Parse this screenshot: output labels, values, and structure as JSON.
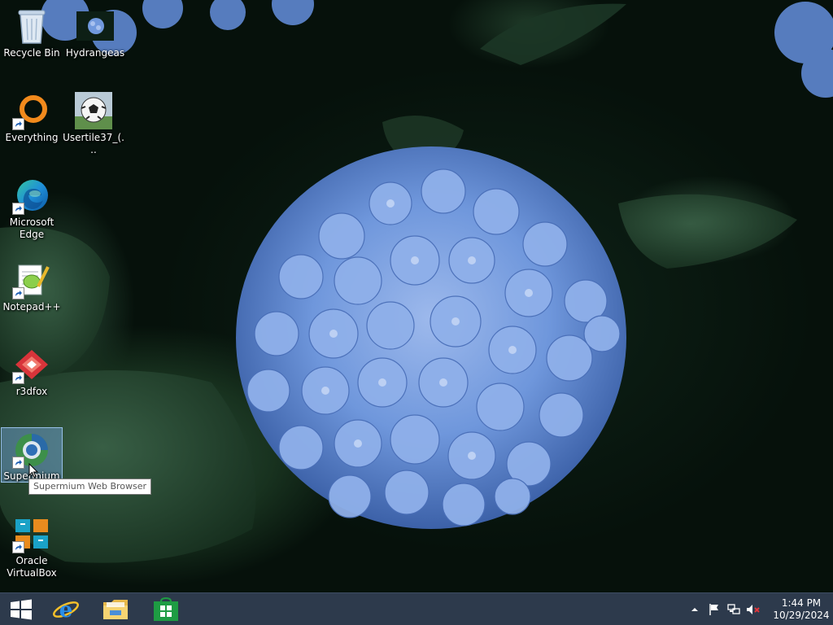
{
  "desktop": {
    "icons": [
      {
        "label": "Recycle Bin",
        "icon": "recycle-bin-icon"
      },
      {
        "label": "Hydrangeas",
        "icon": "image-file-icon"
      },
      {
        "label": "Everything",
        "icon": "everything-icon"
      },
      {
        "label": "Usertile37_(...",
        "icon": "soccer-ball-icon"
      },
      {
        "label": "Microsoft Edge",
        "icon": "edge-icon"
      },
      {
        "label": "Notepad++",
        "icon": "notepadpp-icon"
      },
      {
        "label": "r3dfox",
        "icon": "r3dfox-icon"
      },
      {
        "label": "Supermium",
        "icon": "supermium-icon"
      },
      {
        "label": "Oracle VirtualBox",
        "icon": "virtualbox-icon"
      }
    ],
    "tooltip": "Supermium Web Browser"
  },
  "taskbar": {
    "start_icon": "windows-logo-icon",
    "pinned": [
      {
        "name": "Internet Explorer",
        "icon": "ie-icon"
      },
      {
        "name": "File Explorer",
        "icon": "folder-icon"
      },
      {
        "name": "Store",
        "icon": "store-icon"
      }
    ],
    "tray": {
      "icons": [
        "show-hidden-icons-icon",
        "action-center-flag-icon",
        "network-icon",
        "volume-muted-icon"
      ],
      "time": "1:44 PM",
      "date": "10/29/2024"
    }
  },
  "colors": {
    "taskbar": "#2d3a4c",
    "selection": "#78aae6",
    "hydrangea": "#6f97dc"
  }
}
